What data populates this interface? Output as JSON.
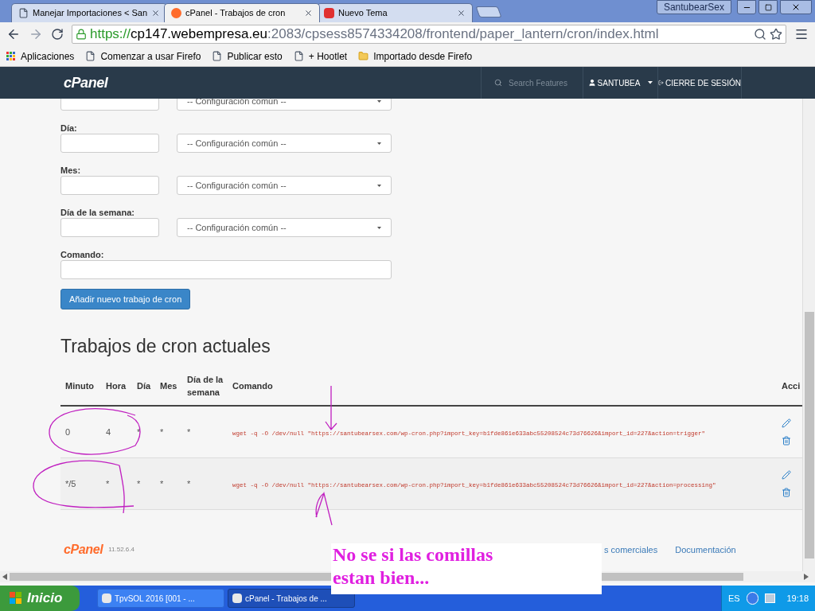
{
  "browser": {
    "tabs": [
      {
        "title": "Manejar Importaciones < San",
        "kind": "page",
        "selected": false
      },
      {
        "title": "cPanel - Trabajos de cron",
        "kind": "cpanel",
        "selected": true
      },
      {
        "title": "Nuevo Tema",
        "kind": "w",
        "selected": false
      }
    ],
    "profile": "SantubearSex",
    "url": {
      "scheme": "https://",
      "host": "cp147.webempresa.eu",
      "rest": ":2083/cpsess8574334208/frontend/paper_lantern/cron/index.html"
    },
    "bookmarks": [
      {
        "label": "Aplicaciones",
        "kind": "apps"
      },
      {
        "label": "Comenzar a usar Firefo",
        "kind": "page"
      },
      {
        "label": "Publicar esto",
        "kind": "page"
      },
      {
        "label": "+ Hootlet",
        "kind": "page"
      },
      {
        "label": "Importado desde Firefo",
        "kind": "folder"
      }
    ]
  },
  "header": {
    "logo": "cPanel",
    "search_placeholder": "Search Features",
    "user": "SANTUBEA",
    "logout": "CIERRE DE SESIÓN"
  },
  "form": {
    "fields": [
      {
        "select": "-- Configuración común --"
      },
      {
        "label": "Día:",
        "select": "-- Configuración común --"
      },
      {
        "label": "Mes:",
        "select": "-- Configuración común --"
      },
      {
        "label": "Día de la semana:",
        "select": "-- Configuración común --"
      }
    ],
    "command_label": "Comando:",
    "submit": "Añadir nuevo trabajo de cron"
  },
  "cron_jobs": {
    "title": "Trabajos de cron actuales",
    "columns": [
      "Minuto",
      "Hora",
      "Día",
      "Mes",
      "Día de la semana",
      "Comando",
      "Acci"
    ],
    "rows": [
      {
        "minute": "0",
        "hour": "4",
        "day": "*",
        "month": "*",
        "weekday": "*",
        "command": "wget -q -O /dev/null \"https://santubearsex.com/wp-cron.php?import_key=b1fde861e633abc55208524c73d76626&import_id=227&action=trigger\""
      },
      {
        "minute": "*/5",
        "hour": "*",
        "day": "*",
        "month": "*",
        "weekday": "*",
        "command": "wget -q -O /dev/null \"https://santubearsex.com/wp-cron.php?import_key=b1fde861e633abc55208524c73d76626&import_id=227&action=processing\""
      }
    ]
  },
  "footer": {
    "logo": "cPanel",
    "version": "11.52.6.4",
    "links": [
      "s comerciales",
      "Documentación"
    ]
  },
  "note": "No se si las comillas estan bien...",
  "taskbar": {
    "start": "Inicio",
    "tasks": [
      {
        "label": "TpvSOL 2016  [001 - ...",
        "selected": false
      },
      {
        "label": "cPanel - Trabajos de ...",
        "selected": true
      }
    ],
    "language": "ES",
    "clock": "19:18"
  }
}
